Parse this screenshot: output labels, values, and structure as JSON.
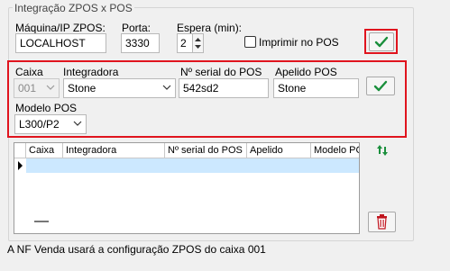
{
  "group": {
    "title": "Integração ZPOS x POS"
  },
  "config": {
    "machine_label": "Máquina/IP ZPOS:",
    "machine_value": "LOCALHOST",
    "port_label": "Porta:",
    "port_value": "3330",
    "wait_label": "Espera (min):",
    "wait_value": "2",
    "print_label": "Imprimir no POS",
    "print_checked": false
  },
  "form": {
    "caixa_label": "Caixa",
    "caixa_value": "001",
    "integradora_label": "Integradora",
    "integradora_value": "Stone",
    "serial_label": "Nº serial do POS",
    "serial_value": "542sd2",
    "apelido_label": "Apelido POS",
    "apelido_value": "Stone",
    "modelo_label": "Modelo POS",
    "modelo_value": "L300/P2"
  },
  "grid": {
    "columns": [
      "Caixa",
      "Integradora",
      "Nº serial do POS",
      "Apelido",
      "Modelo PC"
    ],
    "rows": [
      [
        "",
        "",
        "",
        "",
        ""
      ]
    ]
  },
  "footer": {
    "text": "A NF Venda usará a configuração ZPOS do caixa 001"
  },
  "colors": {
    "accent_green": "#1a8f3c",
    "highlight_red": "#e0141e",
    "row_selected": "#cce8ff"
  }
}
